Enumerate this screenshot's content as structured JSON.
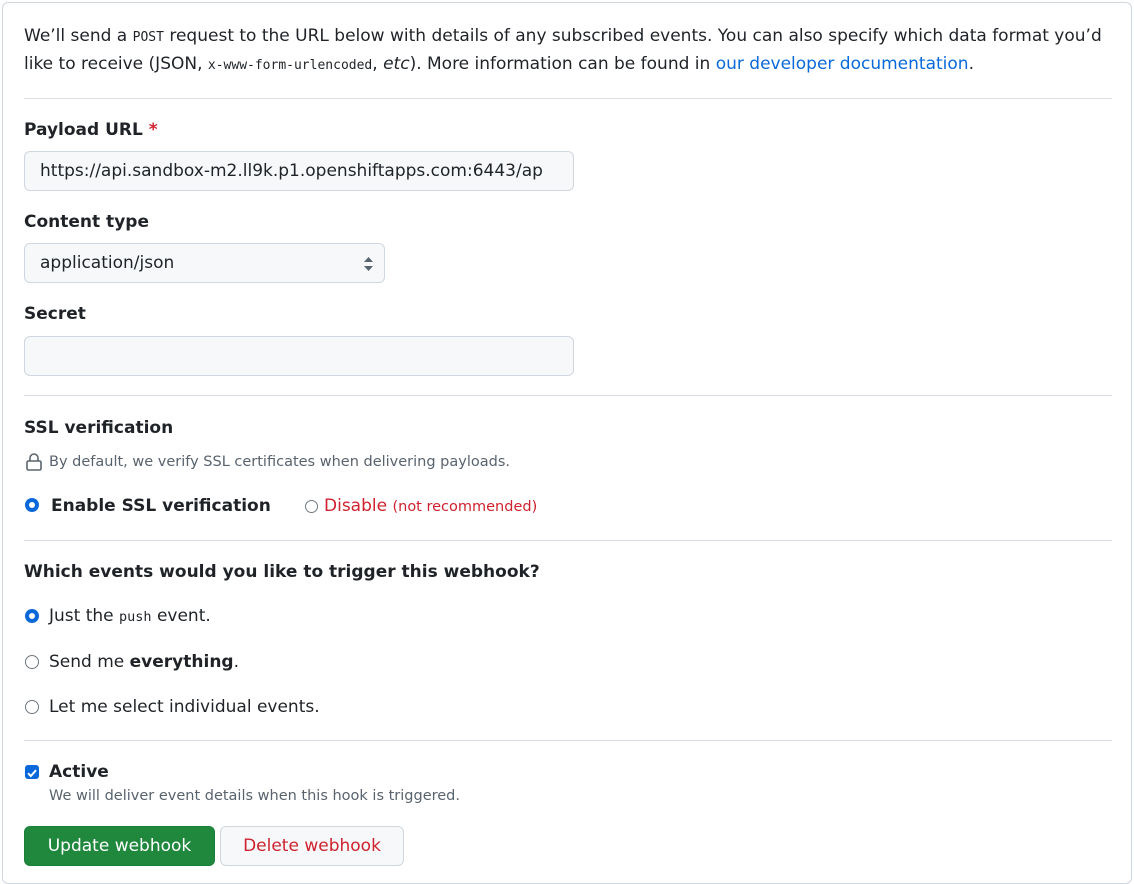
{
  "intro": {
    "part1": "We’ll send a ",
    "code1": "POST",
    "part2": " request to the URL below with details of any subscribed events. You can also specify which data format you’d like to receive (JSON, ",
    "code2": "x-www-form-urlencoded",
    "part3": ", ",
    "em": "etc",
    "part4": "). More information can be found in ",
    "link": "our developer documentation",
    "part5": "."
  },
  "payload_url": {
    "label": "Payload URL",
    "required_mark": "*",
    "value": "https://api.sandbox-m2.ll9k.p1.openshiftapps.com:6443/ap"
  },
  "content_type": {
    "label": "Content type",
    "selected": "application/json"
  },
  "secret": {
    "label": "Secret",
    "value": ""
  },
  "ssl": {
    "label": "SSL verification",
    "note": "By default, we verify SSL certificates when delivering payloads.",
    "enable_label": "Enable SSL verification",
    "disable_label": "Disable",
    "disable_hint": "(not recommended)"
  },
  "events": {
    "question": "Which events would you like to trigger this webhook?",
    "opt1_pre": "Just the ",
    "opt1_code": "push",
    "opt1_post": " event.",
    "opt2_pre": "Send me ",
    "opt2_bold": "everything",
    "opt2_post": ".",
    "opt3": "Let me select individual events."
  },
  "active": {
    "label": "Active",
    "note": "We will deliver event details when this hook is triggered."
  },
  "buttons": {
    "update": "Update webhook",
    "delete": "Delete webhook"
  },
  "colors": {
    "accent": "#0969da",
    "primary_button": "#1f883d",
    "danger": "#cf222e"
  }
}
